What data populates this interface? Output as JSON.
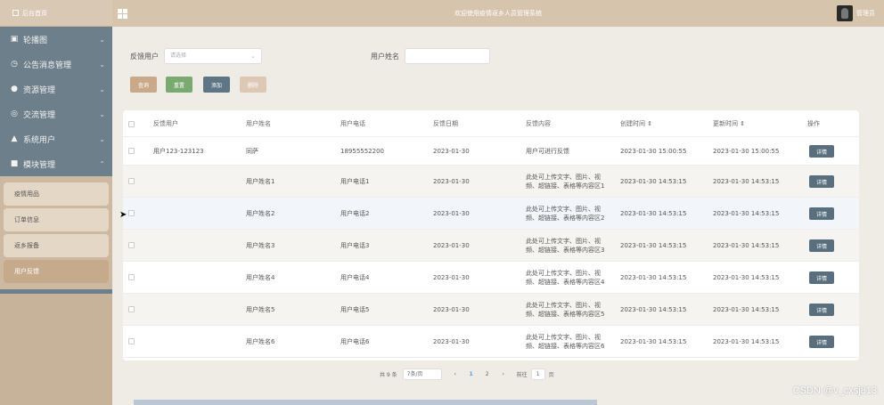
{
  "sidebar": {
    "top_label": "后台首页",
    "items": [
      {
        "label": "轮播图",
        "icon": "image-icon"
      },
      {
        "label": "公告消息管理",
        "icon": "clock-icon"
      },
      {
        "label": "资源管理",
        "icon": "location-icon"
      },
      {
        "label": "交流管理",
        "icon": "circle-icon"
      },
      {
        "label": "系统用户",
        "icon": "user-icon"
      },
      {
        "label": "模块管理",
        "icon": "grid-icon"
      }
    ],
    "sub_items": [
      "疫情用品",
      "订单信息",
      "返乡报备",
      "用户反馈"
    ]
  },
  "header": {
    "title": "欢迎使用疫情返乡人员管理系统",
    "user": "管理员"
  },
  "search": {
    "label_feedback_user": "反馈用户",
    "select_placeholder": "请选择",
    "label_user_name": "用户姓名"
  },
  "buttons": {
    "query": "查询",
    "reset": "重置",
    "add": "添加",
    "delete": "删除"
  },
  "table": {
    "columns": [
      "反馈用户",
      "用户姓名",
      "用户电话",
      "反馈日期",
      "反馈内容",
      "创建时间 ⇕",
      "更新时间 ⇕",
      "操作"
    ],
    "detail_label": "详情",
    "rows": [
      {
        "feedback_user": "用户123-123123",
        "name": "同萨",
        "phone": "18955552200",
        "date": "2023-01-30",
        "content1": "用户可进行反馈",
        "content2": "",
        "created": "2023-01-30 15:00:55",
        "updated": "2023-01-30 15:00:55"
      },
      {
        "feedback_user": "",
        "name": "用户姓名1",
        "phone": "用户电话1",
        "date": "2023-01-30",
        "content1": "此处可上传文字、图片、视",
        "content2": "频、超链接、表格等内容区1",
        "created": "2023-01-30 14:53:15",
        "updated": "2023-01-30 14:53:15"
      },
      {
        "feedback_user": "",
        "name": "用户姓名2",
        "phone": "用户电话2",
        "date": "2023-01-30",
        "content1": "此处可上传文字、图片、视",
        "content2": "频、超链接、表格等内容区2",
        "created": "2023-01-30 14:53:15",
        "updated": "2023-01-30 14:53:15"
      },
      {
        "feedback_user": "",
        "name": "用户姓名3",
        "phone": "用户电话3",
        "date": "2023-01-30",
        "content1": "此处可上传文字、图片、视",
        "content2": "频、超链接、表格等内容区3",
        "created": "2023-01-30 14:53:15",
        "updated": "2023-01-30 14:53:15"
      },
      {
        "feedback_user": "",
        "name": "用户姓名4",
        "phone": "用户电话4",
        "date": "2023-01-30",
        "content1": "此处可上传文字、图片、视",
        "content2": "频、超链接、表格等内容区4",
        "created": "2023-01-30 14:53:15",
        "updated": "2023-01-30 14:53:15"
      },
      {
        "feedback_user": "",
        "name": "用户姓名5",
        "phone": "用户电话5",
        "date": "2023-01-30",
        "content1": "此处可上传文字、图片、视",
        "content2": "频、超链接、表格等内容区5",
        "created": "2023-01-30 14:53:15",
        "updated": "2023-01-30 14:53:15"
      },
      {
        "feedback_user": "",
        "name": "用户姓名6",
        "phone": "用户电话6",
        "date": "2023-01-30",
        "content1": "此处可上传文字、图片、视",
        "content2": "频、超链接、表格等内容区6",
        "created": "2023-01-30 14:53:15",
        "updated": "2023-01-30 14:53:15"
      }
    ]
  },
  "pagination": {
    "total": "共 9 条",
    "page_size": "7条/页",
    "prev": "‹",
    "pages": [
      "1",
      "2"
    ],
    "next": "›",
    "goto_label": "前往",
    "goto_value": "1",
    "page_unit": "页"
  },
  "watermark": "CSDN @v_cxsj813"
}
